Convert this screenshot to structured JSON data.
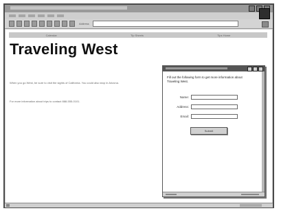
{
  "browser": {
    "address_label": "Address"
  },
  "nav": {
    "items": [
      "Calendar",
      "Tip Sheets",
      "Tips Home"
    ]
  },
  "page": {
    "title": "Traveling West",
    "intro": "When you go West, be sure to visit the sights of California. You could also stop in Arizona.",
    "note": "For more information about trips to contact 888-555-0101."
  },
  "popup": {
    "intro": "Fill out the following form to get more information about Traveling West.",
    "fields": [
      {
        "label": "Name:",
        "value": ""
      },
      {
        "label": "Address:",
        "value": ""
      },
      {
        "label": "Email:",
        "value": ""
      }
    ],
    "submit_label": "Submit"
  }
}
